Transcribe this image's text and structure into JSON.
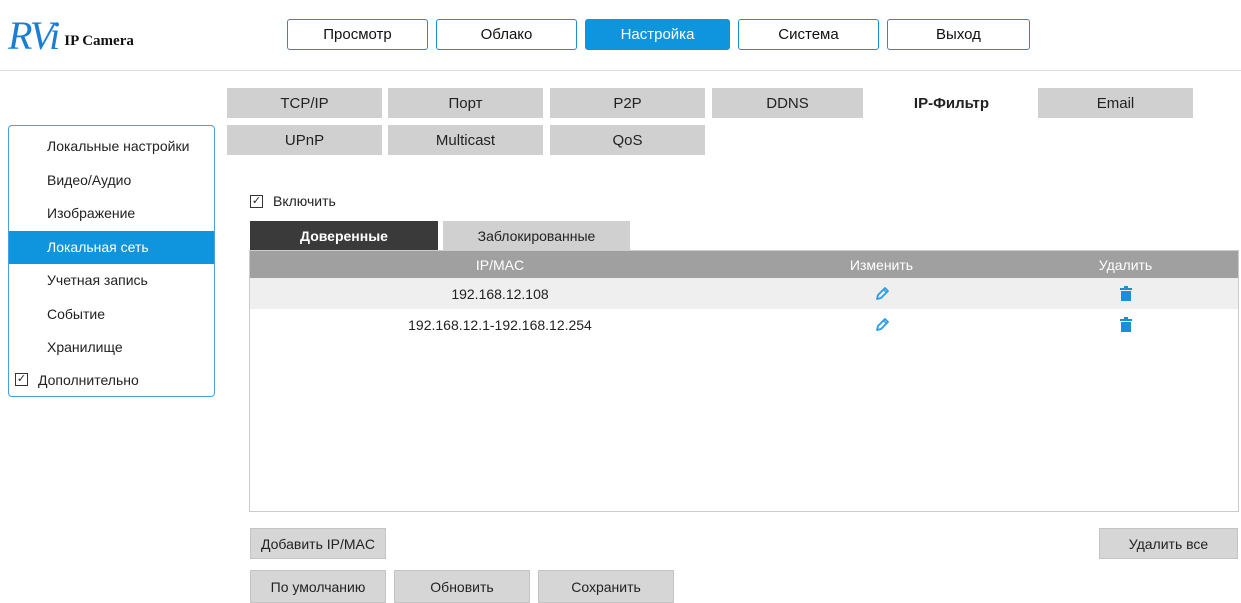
{
  "brand": {
    "logo_mark": "RVi",
    "logo_text": "IP Camera",
    "accent": "#0f94de"
  },
  "top_nav": [
    {
      "label": "Просмотр"
    },
    {
      "label": "Облако"
    },
    {
      "label": "Настройка"
    },
    {
      "label": "Система"
    },
    {
      "label": "Выход"
    }
  ],
  "sidebar": {
    "items": [
      {
        "label": "Локальные настройки"
      },
      {
        "label": "Видео/Аудио"
      },
      {
        "label": "Изображение"
      },
      {
        "label": "Локальная сеть"
      },
      {
        "label": "Учетная запись"
      },
      {
        "label": "Событие"
      },
      {
        "label": "Хранилище"
      }
    ],
    "advanced": {
      "label": "Дополнительно",
      "checked": true
    }
  },
  "tabs": {
    "row1": [
      "TCP/IP",
      "Порт",
      "P2P",
      "DDNS",
      "IP-Фильтр",
      "Email"
    ],
    "row2": [
      "UPnP",
      "Multicast",
      "QoS"
    ]
  },
  "enable": {
    "label": "Включить",
    "checked": true
  },
  "subtabs": {
    "trusted": "Доверенные",
    "blocked": "Заблокированные"
  },
  "table": {
    "headers": {
      "ip": "IP/MAC",
      "edit": "Изменить",
      "delete": "Удалить"
    },
    "rows": [
      {
        "ip": "192.168.12.108"
      },
      {
        "ip": "192.168.12.1-192.168.12.254"
      }
    ]
  },
  "buttons": {
    "add": "Добавить IP/MAC",
    "delete_all": "Удалить все",
    "default": "По умолчанию",
    "refresh": "Обновить",
    "save": "Сохранить"
  }
}
